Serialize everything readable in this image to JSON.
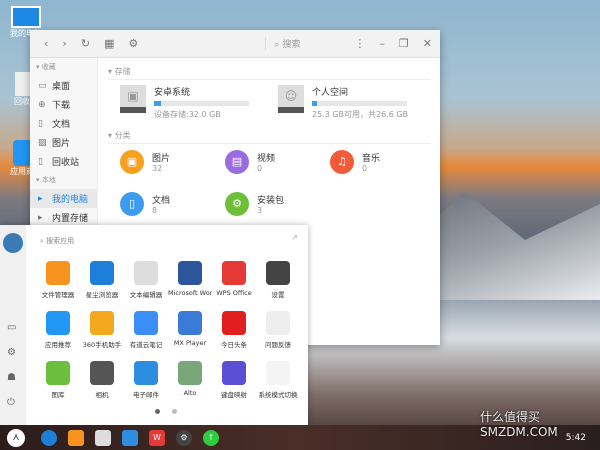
{
  "desktop": {
    "icons": [
      {
        "label": "我的电脑"
      },
      {
        "label": "回收站"
      },
      {
        "label": "应用商店"
      }
    ]
  },
  "file_manager": {
    "toolbar": {
      "search_placeholder": "搜索"
    },
    "sidebar": {
      "favorites_header": "收藏",
      "favorites": [
        "桌面",
        "下载",
        "文档",
        "图片",
        "回收站"
      ],
      "local_header": "本地",
      "local": [
        "我的电脑",
        "内置存储"
      ]
    },
    "storage_header": "存储",
    "storage": [
      {
        "name": "安卓系统",
        "detail": "设备存储:32.0 GB",
        "usage": 0.07
      },
      {
        "name": "个人空间",
        "detail": "25.3 GB可用，共26.6 GB",
        "usage": 0.05
      }
    ],
    "category_header": "分类",
    "categories": [
      {
        "name": "图片",
        "count": "32",
        "color": "#f7a01e"
      },
      {
        "name": "视频",
        "count": "0",
        "color": "#9b6be0"
      },
      {
        "name": "音乐",
        "count": "0",
        "color": "#f25b3a"
      },
      {
        "name": "文档",
        "count": "8",
        "color": "#3d9cf0"
      },
      {
        "name": "安装包",
        "count": "3",
        "color": "#6dbf3a"
      }
    ]
  },
  "launcher": {
    "search_placeholder": "搜索应用",
    "apps": [
      {
        "label": "文件管理器",
        "color": "#f7931e"
      },
      {
        "label": "星尘浏览器",
        "color": "#1e7fd8"
      },
      {
        "label": "文本编辑器",
        "color": "#ddd"
      },
      {
        "label": "Microsoft Word",
        "color": "#2b579a"
      },
      {
        "label": "WPS Office",
        "color": "#e53935"
      },
      {
        "label": "设置",
        "color": "#444"
      },
      {
        "label": "应用推荐",
        "color": "#2196f3"
      },
      {
        "label": "360手机助手",
        "color": "#f4a81d"
      },
      {
        "label": "有道云笔记",
        "color": "#3a8ef6"
      },
      {
        "label": "MX Player",
        "color": "#3a7bd5"
      },
      {
        "label": "今日头条",
        "color": "#e02020"
      },
      {
        "label": "问题反馈",
        "color": "#eee"
      },
      {
        "label": "图库",
        "color": "#6cbf3c"
      },
      {
        "label": "相机",
        "color": "#555"
      },
      {
        "label": "电子邮件",
        "color": "#2d8ee0"
      },
      {
        "label": "Alto",
        "color": "#7aa77a"
      },
      {
        "label": "键盘映射",
        "color": "#5b4fd6"
      },
      {
        "label": "系统模式切换",
        "color": "#f4f4f4"
      }
    ],
    "page": 1,
    "pages": 2
  },
  "taskbar": {
    "time": "5:42"
  },
  "watermark": "什么值得买 SMZDM.COM"
}
